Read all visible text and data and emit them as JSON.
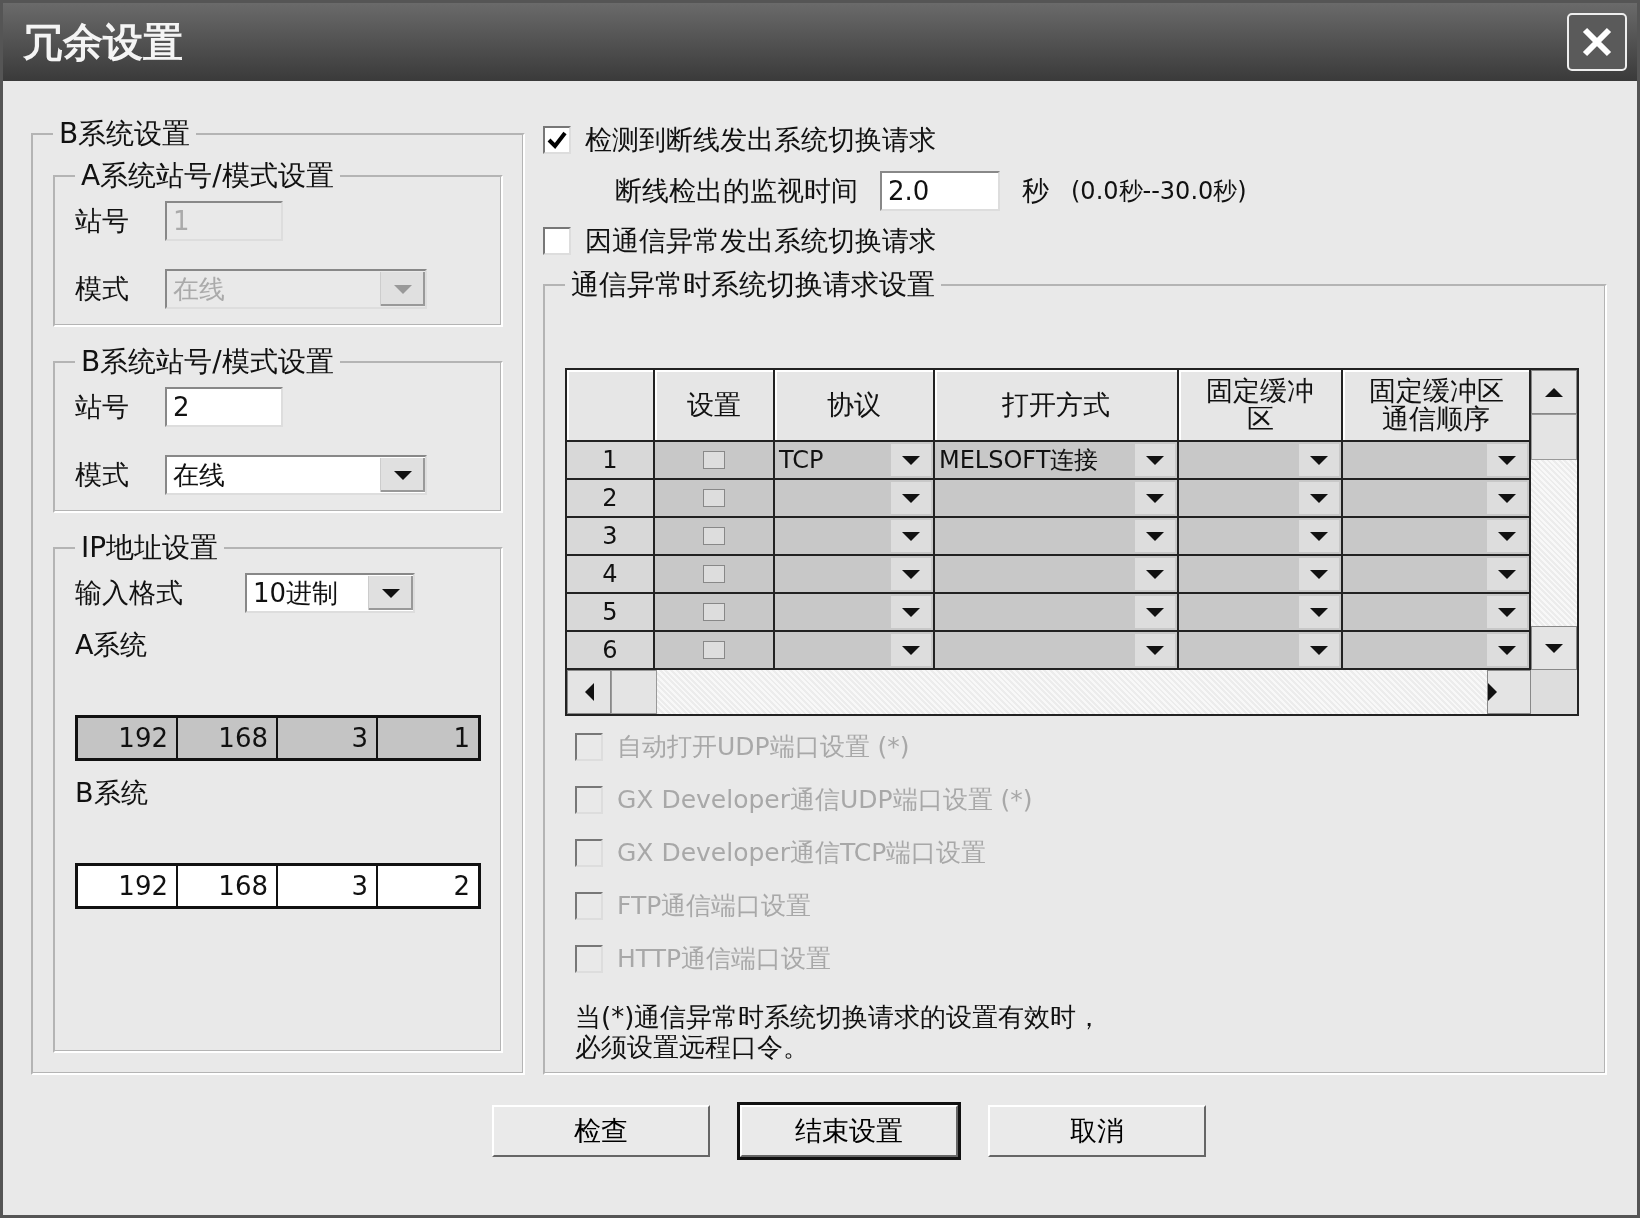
{
  "window": {
    "title": "冗余设置"
  },
  "b_system_settings": {
    "title": "B系统设置",
    "a_station": {
      "title": "A系统站号/模式设置",
      "station_label": "站号",
      "station": "1",
      "mode_label": "模式",
      "mode": "在线",
      "disabled": true
    },
    "b_station": {
      "title": "B系统站号/模式设置",
      "station_label": "站号",
      "station": "2",
      "mode_label": "模式",
      "mode": "在线",
      "disabled": false
    },
    "ip": {
      "title": "IP地址设置",
      "format_label": "输入格式",
      "format": "10进制",
      "systems": [
        {
          "label": "A系统",
          "octets": [
            "192",
            "168",
            "3",
            "1"
          ],
          "disabled": true
        },
        {
          "label": "B系统",
          "octets": [
            "192",
            "168",
            "3",
            "2"
          ],
          "disabled": false
        }
      ]
    }
  },
  "right": {
    "disconnect_check": {
      "label": "检测到断线发出系统切换请求",
      "checked": true
    },
    "monitor": {
      "label": "断线检出的监视时间",
      "value": "2.0",
      "unit": "秒",
      "range": "(0.0秒--30.0秒)"
    },
    "comm_error_check": {
      "label": "因通信异常发出系统切换请求",
      "checked": false
    },
    "comm_group": {
      "title": "通信异常时系统切换请求设置",
      "table": {
        "columns": [
          "设置",
          "协议",
          "打开方式",
          "固定缓冲区",
          "固定缓冲区通信顺序"
        ],
        "rows": [
          {
            "number": "1",
            "checked": false,
            "protocol": "TCP",
            "open_method": "MELSOFT连接"
          },
          {
            "number": "2",
            "checked": false
          },
          {
            "number": "3",
            "checked": false
          },
          {
            "number": "4",
            "checked": false
          },
          {
            "number": "5",
            "checked": false
          },
          {
            "number": "6",
            "checked": false
          }
        ]
      },
      "options": [
        {
          "label": "自动打开UDP端口设置 (*)",
          "checked": false,
          "disabled": true
        },
        {
          "label": "GX Developer通信UDP端口设置 (*)",
          "checked": false,
          "disabled": true
        },
        {
          "label": "GX Developer通信TCP端口设置",
          "checked": false,
          "disabled": true
        },
        {
          "label": "FTP通信端口设置",
          "checked": false,
          "disabled": true
        },
        {
          "label": "HTTP通信端口设置",
          "checked": false,
          "disabled": true
        }
      ],
      "note": [
        "当(*)通信异常时系统切换请求的设置有效时，",
        "必须设置远程口令。"
      ]
    }
  },
  "buttons": [
    {
      "label": "检查",
      "default": false
    },
    {
      "label": "结束设置",
      "default": true
    },
    {
      "label": "取消",
      "default": false
    }
  ]
}
